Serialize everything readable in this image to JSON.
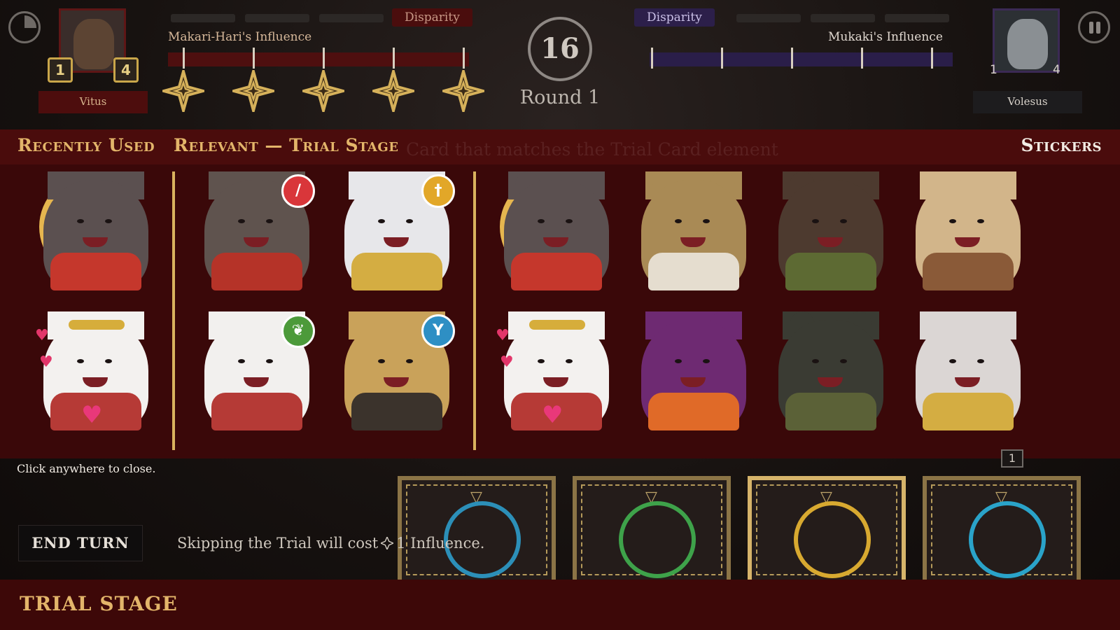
{
  "hud": {
    "left_player": {
      "name": "Vitus",
      "influence_label": "Makari-Hari's Influence",
      "disparity_label": "Disparity",
      "badge_a": "1",
      "badge_b": "4",
      "color": "#4e0f0f"
    },
    "right_player": {
      "name": "Volesus",
      "influence_label": "Mukaki's Influence",
      "disparity_label": "Disparity",
      "badge_a": "1",
      "badge_b": "4",
      "color": "#2a1e49"
    },
    "timer": "16",
    "round_label": "Round 1",
    "menu_icon": "pie-timer-icon",
    "pause_icon": "pause-icon"
  },
  "sticker_panel": {
    "recently_used_label": "Recently Used",
    "relevant_label": "Relevant — Trial Stage",
    "stickers_label": "Stickers",
    "ghost_hint": "Card that matches the Trial Card element",
    "recent": [
      {
        "name": "hyena-thumbs-up",
        "fur": "#5b5050",
        "garment": "#c5372c",
        "halo": true
      },
      {
        "name": "bear-heart-hands",
        "fur": "#f3f1ef",
        "garment": "#b63a36",
        "heart": true
      }
    ],
    "relevant": [
      {
        "name": "wolf-sword",
        "fur": "#5f534e",
        "garment": "#b53328",
        "bubble": "sword-icon",
        "bubble_color": "#d9363a",
        "glyph": "/"
      },
      {
        "name": "snow-leopard-dagger",
        "fur": "#e7e7ea",
        "garment": "#d4ad42",
        "bubble": "dagger-icon",
        "bubble_color": "#e2a728",
        "glyph": "†"
      },
      {
        "name": "bear-laurel",
        "fur": "#f2f0ee",
        "garment": "#b53a36",
        "bubble": "laurel-icon",
        "bubble_color": "#4c9a3a",
        "glyph": "❦"
      },
      {
        "name": "cheetah-goblet",
        "fur": "#c9a25a",
        "garment": "#3b332c",
        "bubble": "goblet-icon",
        "bubble_color": "#2e8fc4",
        "glyph": "Y"
      }
    ],
    "all": [
      {
        "name": "hyena-thumbs-up",
        "fur": "#5b5050",
        "garment": "#c5372c",
        "halo": true
      },
      {
        "name": "lion-arms-crossed",
        "fur": "#a98a55",
        "garment": "#e5ddcf"
      },
      {
        "name": "boar-stone",
        "fur": "#4d3a2f",
        "garment": "#5d6a33"
      },
      {
        "name": "leopard-tankard",
        "fur": "#d2b58a",
        "garment": "#8a5a38"
      },
      {
        "name": "bear-heart-hands",
        "fur": "#f3f1ef",
        "garment": "#b63a36",
        "heart": true
      },
      {
        "name": "demon-peace-sign",
        "fur": "#6e2a72",
        "garment": "#e06a28"
      },
      {
        "name": "rhino-stone",
        "fur": "#3a3b33",
        "garment": "#5b6137"
      },
      {
        "name": "snow-leopard-sparkle",
        "fur": "#dbd6d4",
        "garment": "#d4ad42"
      }
    ]
  },
  "close_hint": "Click anywhere to close.",
  "end_turn_label": "END TURN",
  "skip_text_before": "Skipping the Trial will cost",
  "skip_text_after": "1 Influence.",
  "hand_counter": "1",
  "cards": [
    {
      "name": "card-blue-ribbon",
      "color": "#2c8fb8"
    },
    {
      "name": "card-green-ribbon",
      "color": "#3ea24a"
    },
    {
      "name": "card-gold-circle",
      "color": "#d8a930"
    },
    {
      "name": "card-cyan-ribbon",
      "color": "#2aa3c9"
    }
  ],
  "stage_label": "TRIAL STAGE"
}
